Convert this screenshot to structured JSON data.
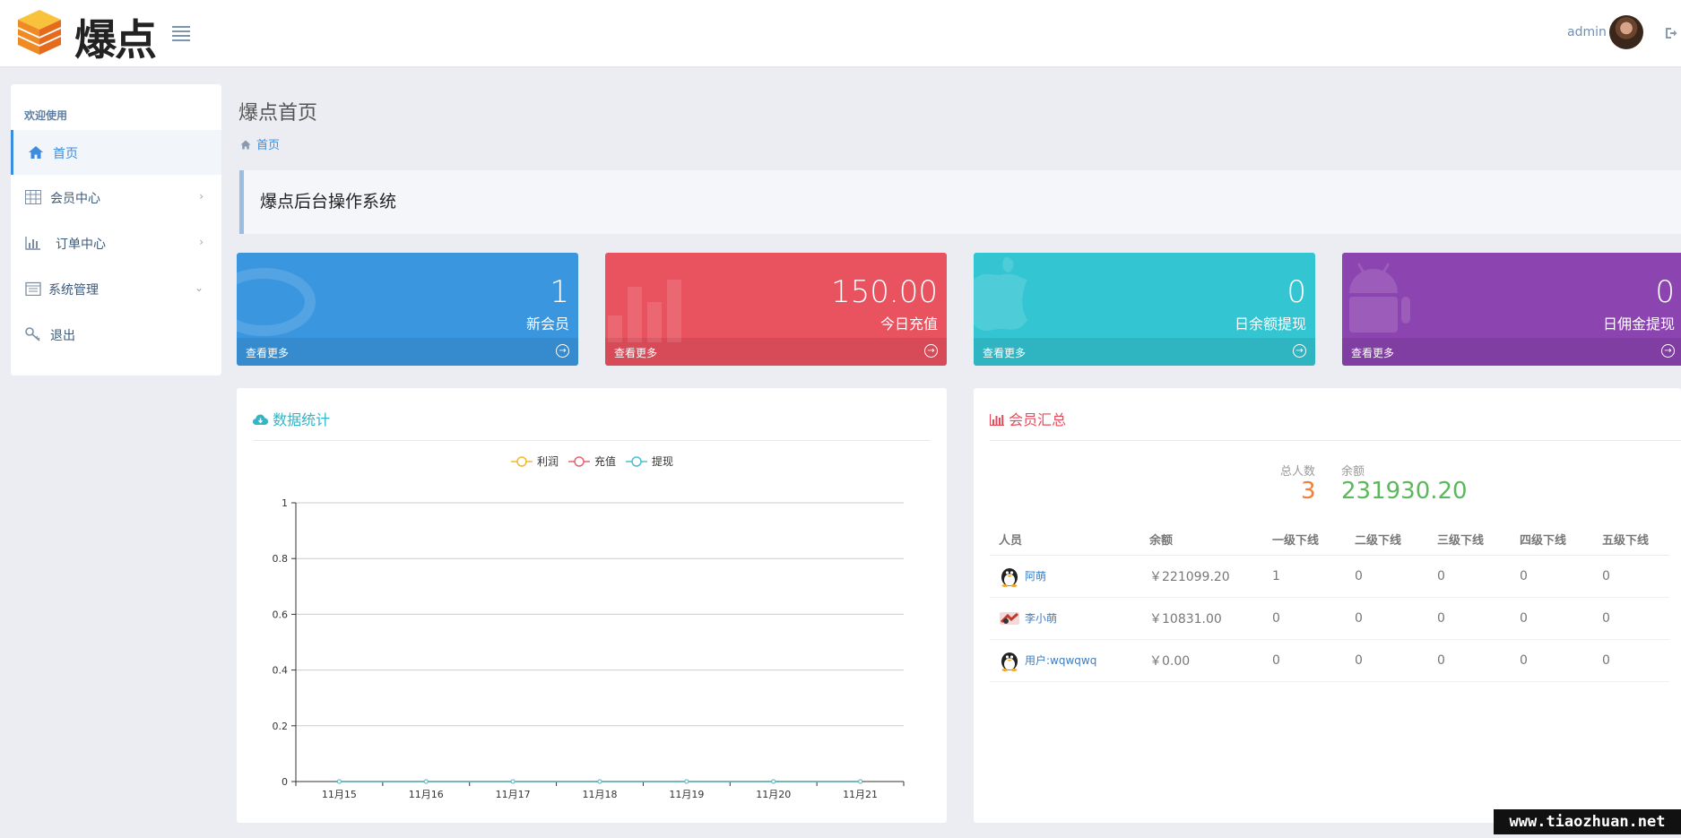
{
  "app": {
    "logo_text": "爆点"
  },
  "header": {
    "user_name": "admin"
  },
  "sidebar": {
    "heading": "欢迎使用",
    "items": [
      {
        "label": "首页",
        "icon": "home-icon",
        "active": true
      },
      {
        "label": "会员中心",
        "icon": "table-icon",
        "arrow": "›"
      },
      {
        "label": "订单中心",
        "icon": "bar-chart-icon",
        "arrow": "›"
      },
      {
        "label": "系统管理",
        "icon": "calendar-icon",
        "arrow": "⌄"
      },
      {
        "label": "退出",
        "icon": "key-icon"
      }
    ]
  },
  "page": {
    "title": "爆点首页",
    "breadcrumb": "首页",
    "callout": "爆点后台操作系统"
  },
  "tiles": [
    {
      "value": "1",
      "label": "新会员",
      "more": "查看更多",
      "color": "#3a97df"
    },
    {
      "value": "150.00",
      "label": "今日充值",
      "more": "查看更多",
      "color": "#e9525f"
    },
    {
      "value": "0",
      "label": "日余额提现",
      "more": "查看更多",
      "color": "#33c5d2"
    },
    {
      "value": "0",
      "label": "日佣金提现",
      "more": "查看更多",
      "color": "#8c44b0"
    }
  ],
  "stats_panel": {
    "title": "数据统计",
    "title_color": "#32b5c6",
    "legend": [
      "利润",
      "充值",
      "提现"
    ],
    "legend_colors": [
      "#f5b82e",
      "#e46570",
      "#4cc0cf"
    ]
  },
  "chart_data": {
    "type": "line",
    "categories": [
      "11月15",
      "11月16",
      "11月17",
      "11月18",
      "11月19",
      "11月20",
      "11月21"
    ],
    "series": [
      {
        "name": "利润",
        "values": [
          0,
          0,
          0,
          0,
          0,
          0,
          0
        ]
      },
      {
        "name": "充值",
        "values": [
          0,
          0,
          0,
          0,
          0,
          0,
          0
        ]
      },
      {
        "name": "提现",
        "values": [
          0,
          0,
          0,
          0,
          0,
          0,
          0
        ]
      }
    ],
    "yticks": [
      "0",
      "0.2",
      "0.4",
      "0.6",
      "0.8",
      "1"
    ],
    "ylim": [
      0,
      1
    ],
    "grid": true,
    "legend_position": "top-center"
  },
  "members_panel": {
    "title": "会员汇总",
    "title_color": "#e64a5a",
    "total_label": "总人数",
    "total_value": "3",
    "balance_label": "余额",
    "balance_value": "231930.20",
    "columns": [
      "人员",
      "余额",
      "一级下线",
      "二级下线",
      "三级下线",
      "四级下线",
      "五级下线"
    ],
    "rows": [
      {
        "name": "阿萌",
        "balance": "￥221099.20",
        "l1": "1",
        "l2": "0",
        "l3": "0",
        "l4": "0",
        "l5": "0",
        "avatar": "penguin-avatar-icon"
      },
      {
        "name": "李小萌",
        "balance": "￥10831.00",
        "l1": "0",
        "l2": "0",
        "l3": "0",
        "l4": "0",
        "l5": "0",
        "avatar": "photo-avatar-icon"
      },
      {
        "name": "用户:wqwqwq",
        "balance": "￥0.00",
        "l1": "0",
        "l2": "0",
        "l3": "0",
        "l4": "0",
        "l5": "0",
        "avatar": "penguin-avatar-icon"
      }
    ]
  },
  "watermark": "www.tiaozhuan.net"
}
